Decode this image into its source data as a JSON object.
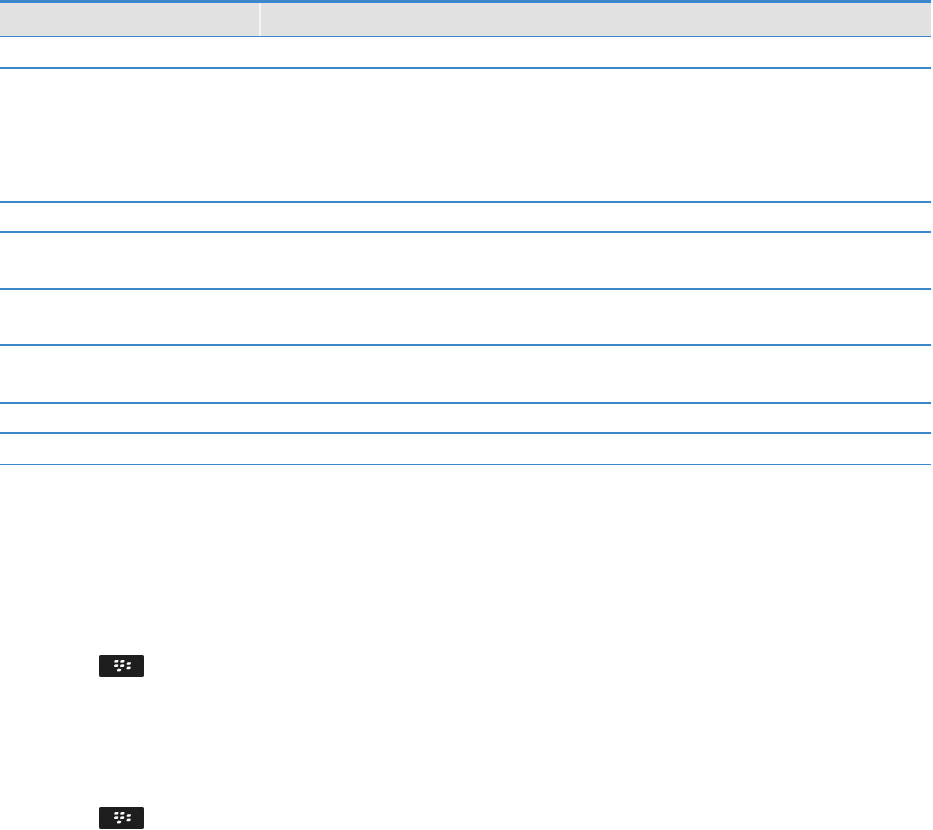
{
  "table": {
    "header": {
      "col_a": "",
      "col_b": ""
    },
    "rows": [
      {
        "col_a": "",
        "col_b": ""
      },
      {
        "col_a": "",
        "col_b": ""
      },
      {
        "col_a": "",
        "col_b": ""
      },
      {
        "col_a": "",
        "col_b": ""
      },
      {
        "col_a": "",
        "col_b": ""
      },
      {
        "col_a": "",
        "col_b": ""
      },
      {
        "col_a": "",
        "col_b": ""
      },
      {
        "col_a": "",
        "col_b": ""
      }
    ]
  },
  "icons": {
    "menu_key_1": "blackberry-menu-key-icon",
    "menu_key_2": "blackberry-menu-key-icon"
  },
  "colors": {
    "rule": "#3c86cc",
    "header_bg": "#e1e1e1",
    "key_bg": "#1e1e1e"
  }
}
